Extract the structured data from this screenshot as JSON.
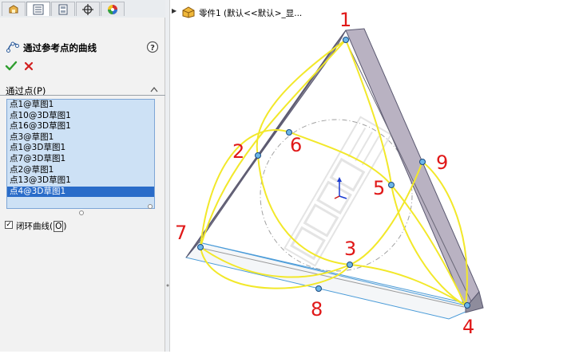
{
  "property_manager": {
    "tabs": [
      {
        "icon": "feature-manager-icon"
      },
      {
        "icon": "property-manager-icon"
      },
      {
        "icon": "configuration-manager-icon"
      },
      {
        "icon": "dimxpert-icon"
      },
      {
        "icon": "display-manager-icon"
      }
    ],
    "title": "通过参考点的曲线",
    "help_label": "?",
    "group_label": "通过点(P)",
    "points": [
      "点1@草图1",
      "点10@3D草图1",
      "点16@3D草图1",
      "点3@草图1",
      "点1@3D草图1",
      "点7@3D草图1",
      "点2@草图1",
      "点13@3D草图1",
      "点4@3D草图1"
    ],
    "selected_index": 8,
    "closed_curve": {
      "label": "闭环曲线",
      "shortcut": "O",
      "checked": true,
      "check_mark": "✓"
    }
  },
  "viewport": {
    "tree_item_text": "零件1 (默认<<默认>_显..."
  },
  "annotations": [
    "1",
    "2",
    "3",
    "4",
    "5",
    "6",
    "7",
    "8",
    "9"
  ],
  "colors": {
    "accent": "#2a6cc9",
    "list_bg": "#cde1f5",
    "ok_green": "#2f9e2f",
    "cancel_red": "#d22020",
    "curve_yellow": "#f2e82a",
    "annotation_red": "#e01818",
    "frame_face": "#b4aebd",
    "edge_blue": "#4a9bd8"
  }
}
